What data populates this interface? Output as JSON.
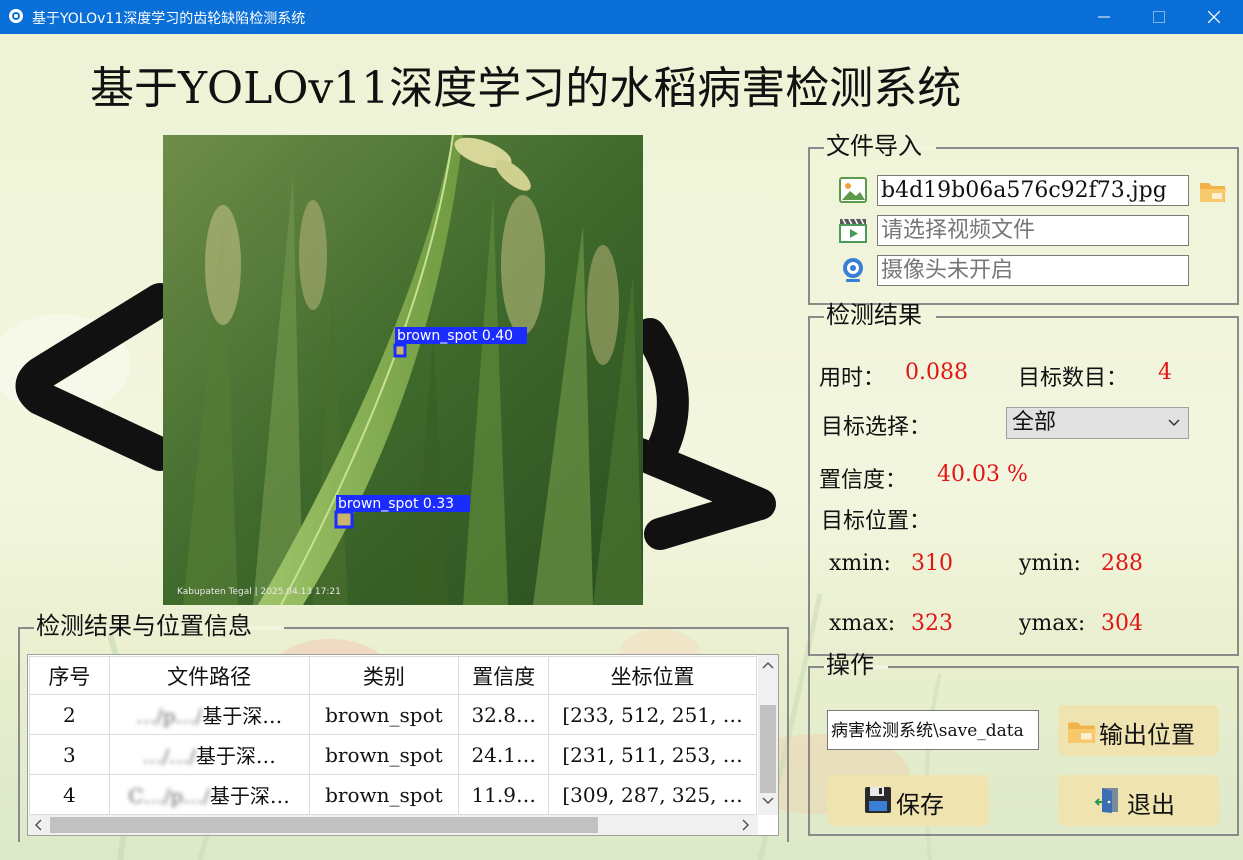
{
  "window": {
    "title": "基于YOLOv11深度学习的齿轮缺陷检测系统"
  },
  "main_title": "基于YOLOv11深度学习的水稻病害检测系统",
  "image_overlay": {
    "detections": [
      {
        "label": "brown_spot 0.40"
      },
      {
        "label": "brown_spot 0.33"
      }
    ],
    "watermark": "Kabupaten Tegal | 2025.04.13 17:21"
  },
  "file_import": {
    "title": "文件导入",
    "image_file": "b4d19b06a576c92f73.jpg",
    "video_placeholder": "请选择视频文件",
    "camera_placeholder": "摄像头未开启"
  },
  "detect_result": {
    "title": "检测结果",
    "time_label": "用时：",
    "time_value": "0.088",
    "count_label": "目标数目：",
    "count_value": "4",
    "select_label": "目标选择：",
    "select_value": "全部",
    "conf_label": "置信度：",
    "conf_value": "40.03 %",
    "pos_label": "目标位置：",
    "xmin_label": "xmin:",
    "xmin_value": "310",
    "ymin_label": "ymin:",
    "ymin_value": "288",
    "xmax_label": "xmax:",
    "xmax_value": "323",
    "ymax_label": "ymax:",
    "ymax_value": "304"
  },
  "operations": {
    "title": "操作",
    "save_path": "病害检测系统\\save_data",
    "output_button": "输出位置",
    "save_button": "保存",
    "exit_button": "退出"
  },
  "table": {
    "title": "检测结果与位置信息",
    "headers": [
      "序号",
      "文件路径",
      "类别",
      "置信度",
      "坐标位置"
    ],
    "rows": [
      {
        "id": "2",
        "path_prefix": "…/p…/",
        "path": "基于深…",
        "cls": "brown_spot",
        "conf": "32.8…",
        "coords": "[233, 512, 251, …"
      },
      {
        "id": "3",
        "path_prefix": "…/…/",
        "path": "基于深…",
        "cls": "brown_spot",
        "conf": "24.1…",
        "coords": "[231, 511, 253, …"
      },
      {
        "id": "4",
        "path_prefix": "C…/p…/",
        "path": "基于深…",
        "cls": "brown_spot",
        "conf": "11.9…",
        "coords": "[309, 287, 325, …"
      }
    ]
  },
  "colors": {
    "titlebar": "#0a6fd6",
    "value_red": "#e21414",
    "button_bg": "#efe4b0",
    "detection_box": "#1a2cff"
  }
}
